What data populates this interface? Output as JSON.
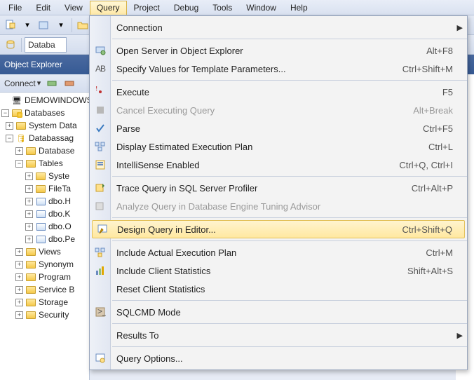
{
  "menubar": [
    "File",
    "Edit",
    "View",
    "Query",
    "Project",
    "Debug",
    "Tools",
    "Window",
    "Help"
  ],
  "menubar_open_index": 3,
  "toolbar_combo": "Databa",
  "object_explorer": {
    "title": "Object Explorer",
    "connect_label": "Connect"
  },
  "tree": [
    {
      "level": 0,
      "tw": "",
      "icon": "server",
      "label": "DEMOWINDOWS"
    },
    {
      "level": 0,
      "tw": "-",
      "icon": "folderdb",
      "label": "Databases"
    },
    {
      "level": 1,
      "tw": "+",
      "icon": "folder",
      "label": "System Data"
    },
    {
      "level": 1,
      "tw": "-",
      "icon": "db",
      "label": "Databassag"
    },
    {
      "level": 2,
      "tw": "+",
      "icon": "folder",
      "label": "Database"
    },
    {
      "level": 2,
      "tw": "-",
      "icon": "folder",
      "label": "Tables"
    },
    {
      "level": 3,
      "tw": "+",
      "icon": "folder",
      "label": "Syste"
    },
    {
      "level": 3,
      "tw": "+",
      "icon": "folder",
      "label": "FileTa"
    },
    {
      "level": 3,
      "tw": "+",
      "icon": "table",
      "label": "dbo.H"
    },
    {
      "level": 3,
      "tw": "+",
      "icon": "table",
      "label": "dbo.K"
    },
    {
      "level": 3,
      "tw": "+",
      "icon": "table",
      "label": "dbo.O"
    },
    {
      "level": 3,
      "tw": "+",
      "icon": "table",
      "label": "dbo.Pe"
    },
    {
      "level": 2,
      "tw": "+",
      "icon": "folder",
      "label": "Views"
    },
    {
      "level": 2,
      "tw": "+",
      "icon": "folder",
      "label": "Synonym"
    },
    {
      "level": 2,
      "tw": "+",
      "icon": "folder",
      "label": "Program"
    },
    {
      "level": 2,
      "tw": "+",
      "icon": "folder",
      "label": "Service B"
    },
    {
      "level": 2,
      "tw": "+",
      "icon": "folder",
      "label": "Storage"
    },
    {
      "level": 2,
      "tw": "+",
      "icon": "folder",
      "label": "Security"
    }
  ],
  "menu": {
    "items": [
      {
        "icon": "",
        "label": "Connection",
        "shortcut": "",
        "sub": true
      },
      {
        "sep": true
      },
      {
        "icon": "open-server",
        "label": "Open Server in Object Explorer",
        "shortcut": "Alt+F8"
      },
      {
        "icon": "template",
        "label": "Specify Values for Template Parameters...",
        "shortcut": "Ctrl+Shift+M"
      },
      {
        "sep": true
      },
      {
        "icon": "execute",
        "label": "Execute",
        "shortcut": "F5"
      },
      {
        "icon": "cancel",
        "label": "Cancel Executing Query",
        "shortcut": "Alt+Break",
        "disabled": true
      },
      {
        "icon": "parse",
        "label": "Parse",
        "shortcut": "Ctrl+F5"
      },
      {
        "icon": "plan",
        "label": "Display Estimated Execution Plan",
        "shortcut": "Ctrl+L"
      },
      {
        "icon": "intellisense",
        "label": "IntelliSense Enabled",
        "shortcut": "Ctrl+Q, Ctrl+I"
      },
      {
        "sep": true
      },
      {
        "icon": "trace",
        "label": "Trace Query in SQL Server Profiler",
        "shortcut": "Ctrl+Alt+P"
      },
      {
        "icon": "analyze",
        "label": "Analyze Query in Database Engine Tuning Advisor",
        "shortcut": "",
        "disabled": true
      },
      {
        "sep": true
      },
      {
        "icon": "design",
        "label": "Design Query in Editor...",
        "shortcut": "Ctrl+Shift+Q",
        "highlight": true
      },
      {
        "sep": true
      },
      {
        "icon": "include-plan",
        "label": "Include Actual Execution Plan",
        "shortcut": "Ctrl+M"
      },
      {
        "icon": "stats",
        "label": "Include Client Statistics",
        "shortcut": "Shift+Alt+S"
      },
      {
        "icon": "",
        "label": "Reset Client Statistics",
        "shortcut": ""
      },
      {
        "sep": true
      },
      {
        "icon": "sqlcmd",
        "label": "SQLCMD Mode",
        "shortcut": ""
      },
      {
        "sep": true
      },
      {
        "icon": "",
        "label": "Results To",
        "shortcut": "",
        "sub": true
      },
      {
        "sep": true
      },
      {
        "icon": "options",
        "label": "Query Options...",
        "shortcut": ""
      }
    ]
  }
}
